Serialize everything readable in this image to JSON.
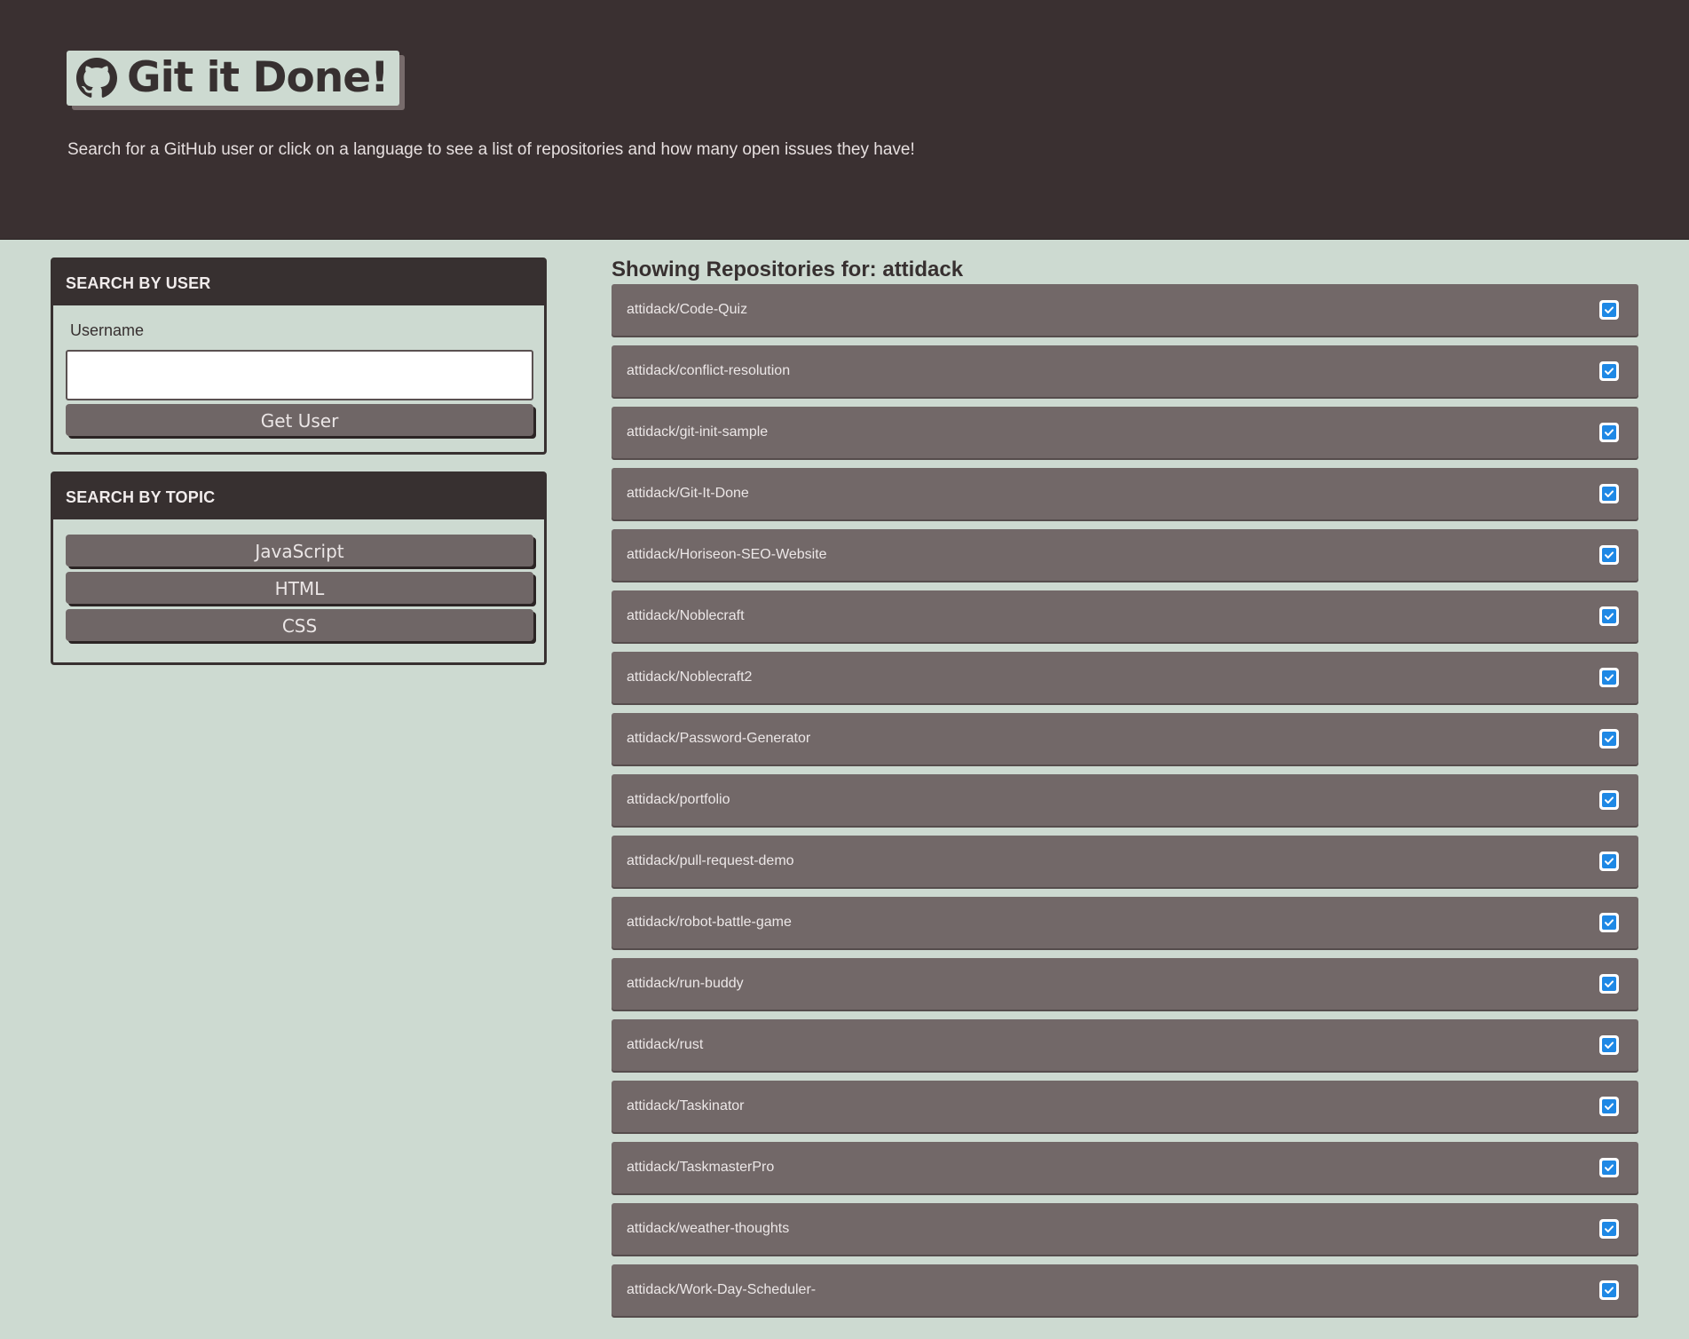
{
  "header": {
    "title": "Git it Done!",
    "subtitle": "Search for a GitHub user or click on a language to see a list of repositories and how many open issues they have!",
    "logo_icon": "github-icon"
  },
  "user_search": {
    "heading": "SEARCH BY USER",
    "field_label": "Username",
    "input_value": "",
    "button_label": "Get User"
  },
  "topic_search": {
    "heading": "SEARCH BY TOPIC",
    "topics": [
      "JavaScript",
      "HTML",
      "CSS"
    ]
  },
  "results": {
    "title": "Showing Repositories for: attidack",
    "status_icon": "check-square-icon",
    "repos": [
      "attidack/Code-Quiz",
      "attidack/conflict-resolution",
      "attidack/git-init-sample",
      "attidack/Git-It-Done",
      "attidack/Horiseon-SEO-Website",
      "attidack/Noblecraft",
      "attidack/Noblecraft2",
      "attidack/Password-Generator",
      "attidack/portfolio",
      "attidack/pull-request-demo",
      "attidack/robot-battle-game",
      "attidack/run-buddy",
      "attidack/rust",
      "attidack/Taskinator",
      "attidack/TaskmasterPro",
      "attidack/weather-thoughts",
      "attidack/Work-Day-Scheduler-"
    ]
  },
  "colors": {
    "header_bg": "#3a3031",
    "page_bg": "#cddad1",
    "repo_bg": "#726868",
    "check_blue": "#1e88e5"
  }
}
